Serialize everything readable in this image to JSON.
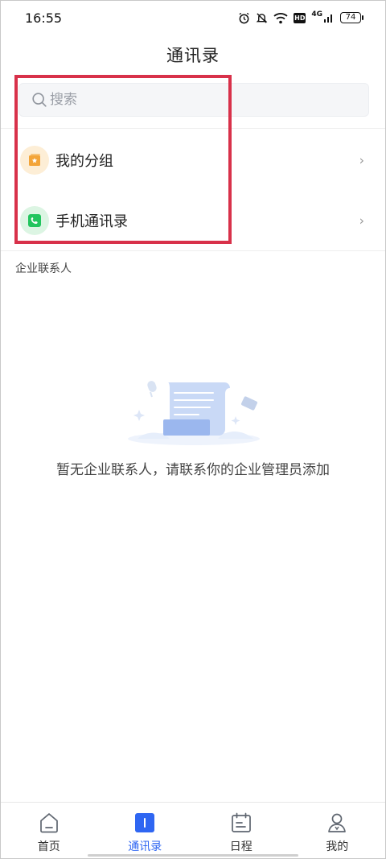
{
  "status_bar": {
    "time": "16:55",
    "hd": "HD",
    "network": "4G",
    "battery": "74"
  },
  "header": {
    "title": "通讯录"
  },
  "search": {
    "placeholder": "搜索"
  },
  "list": {
    "items": [
      {
        "label": "我的分组",
        "icon": "group-star-icon",
        "color": "#f3a53a"
      },
      {
        "label": "手机通讯录",
        "icon": "phone-icon",
        "color": "#22c55e"
      }
    ]
  },
  "section": {
    "title": "企业联系人"
  },
  "empty_state": {
    "message": "暂无企业联系人，请联系你的企业管理员添加"
  },
  "bottom_nav": {
    "items": [
      {
        "label": "首页",
        "icon": "home-icon"
      },
      {
        "label": "通讯录",
        "icon": "contacts-icon",
        "active": true
      },
      {
        "label": "日程",
        "icon": "calendar-icon"
      },
      {
        "label": "我的",
        "icon": "profile-icon"
      }
    ]
  },
  "colors": {
    "accent": "#2f66f2",
    "highlight": "#d8314a",
    "group_icon": "#f3a53a",
    "phone_icon": "#22c55e"
  }
}
